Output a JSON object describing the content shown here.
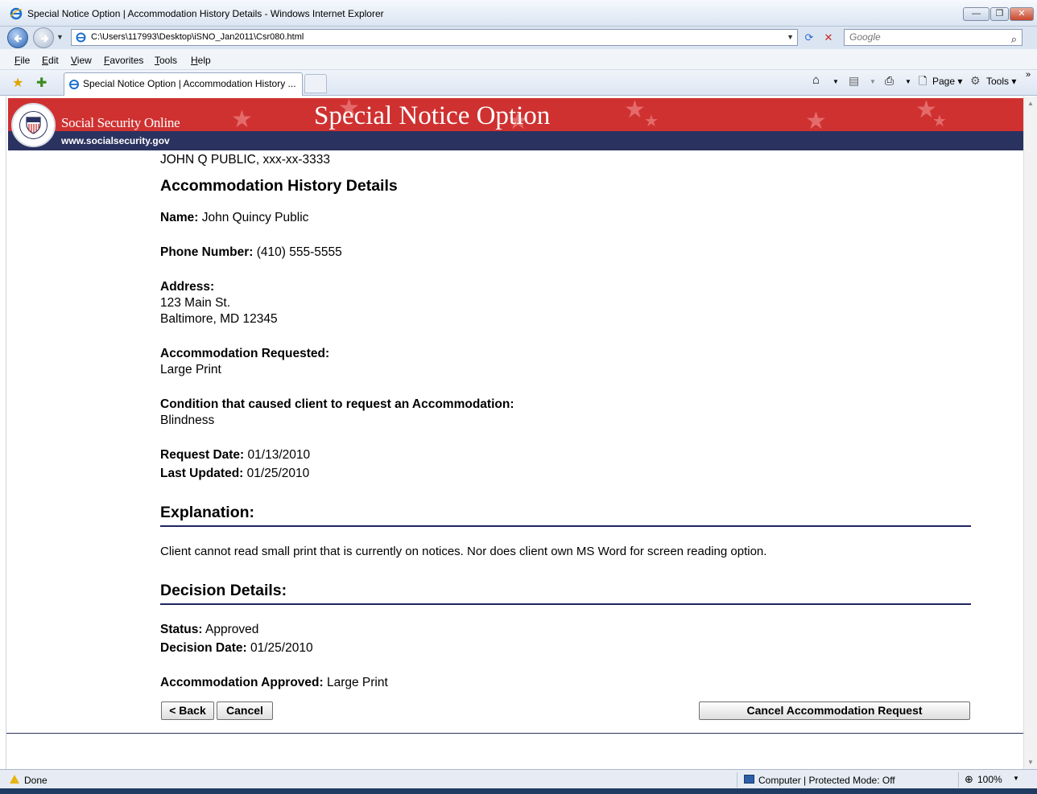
{
  "browser": {
    "window_title": "Special Notice Option | Accommodation History Details - Windows Internet Explorer",
    "address": "C:\\Users\\117993\\Desktop\\iSNO_Jan2011\\Csr080.html",
    "search_placeholder": "Google",
    "menus": [
      "File",
      "Edit",
      "View",
      "Favorites",
      "Tools",
      "Help"
    ],
    "tab_title": "Special Notice Option | Accommodation History ...",
    "commands": {
      "page": "Page",
      "tools": "Tools"
    },
    "status": {
      "text": "Done",
      "zone": "Computer | Protected Mode: Off",
      "zoom": "100%"
    }
  },
  "banner": {
    "brand": "Social Security Online",
    "headline": "Special Notice Option",
    "site_url": "www.socialsecurity.gov",
    "colors": {
      "red": "#cf3131",
      "navy": "#2a3260"
    }
  },
  "page": {
    "client_line": "JOHN Q PUBLIC, xxx-xx-3333",
    "title": "Accommodation History Details",
    "name_label": "Name:",
    "name_value": "John Quincy Public",
    "phone_label": "Phone Number:",
    "phone_value": "(410) 555-5555",
    "address_label": "Address:",
    "address_line1": "123 Main St.",
    "address_line2": "Baltimore, MD 12345",
    "accommodation_label": "Accommodation Requested:",
    "accommodation_value": "Large Print",
    "condition_label": "Condition that caused client to request an Accommodation:",
    "condition_value": "Blindness",
    "request_date_label": "Request Date:",
    "request_date_value": "01/13/2010",
    "last_updated_label": "Last Updated:",
    "last_updated_value": "01/25/2010",
    "explanation_heading": "Explanation:",
    "explanation_text": "Client cannot read small print that is currently on notices. Nor does client own MS Word for screen reading option.",
    "decision_heading": "Decision Details:",
    "status_label": "Status:",
    "status_value": "Approved",
    "decision_date_label": "Decision Date:",
    "decision_date_value": "01/25/2010",
    "approved_label": "Accommodation Approved:",
    "approved_value": "Large Print"
  },
  "buttons": {
    "back": "< Back",
    "cancel": "Cancel",
    "cancel_request": "Cancel Accommodation Request"
  }
}
